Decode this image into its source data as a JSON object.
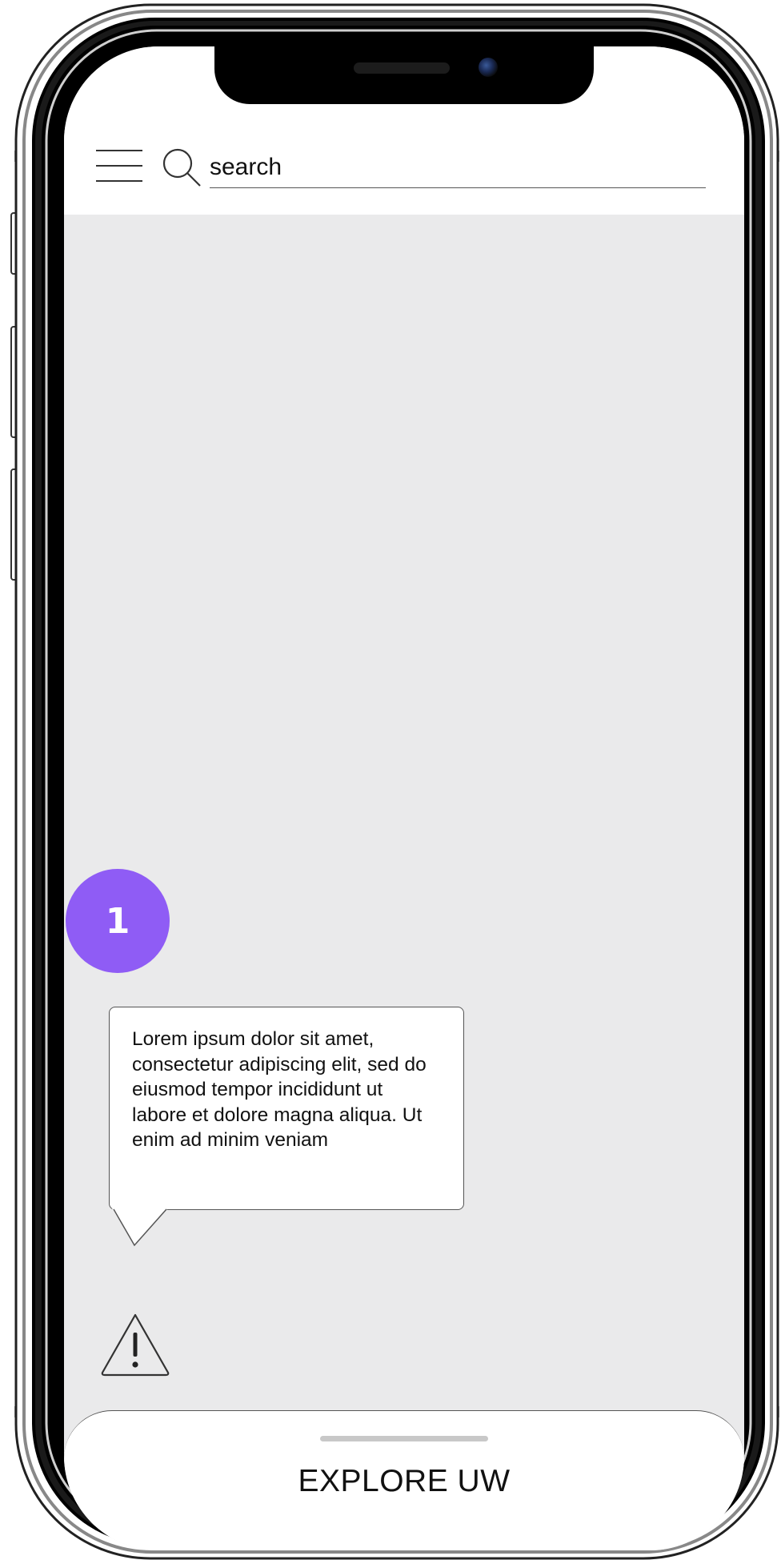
{
  "search": {
    "placeholder": "search"
  },
  "step_badge": {
    "number": "1",
    "color": "#8f5cf5"
  },
  "tooltip": {
    "text": "Lorem ipsum dolor sit amet, consectetur adipiscing elit, sed do eiusmod tempor incididunt ut labore et dolore magna aliqua. Ut enim ad minim veniam"
  },
  "bottom_sheet": {
    "title": "EXPLORE UW"
  },
  "icons": [
    "menu-icon",
    "search-icon",
    "warning-icon"
  ],
  "colors": {
    "screen_background": "#eaeaeb",
    "accent": "#8f5cf5"
  }
}
